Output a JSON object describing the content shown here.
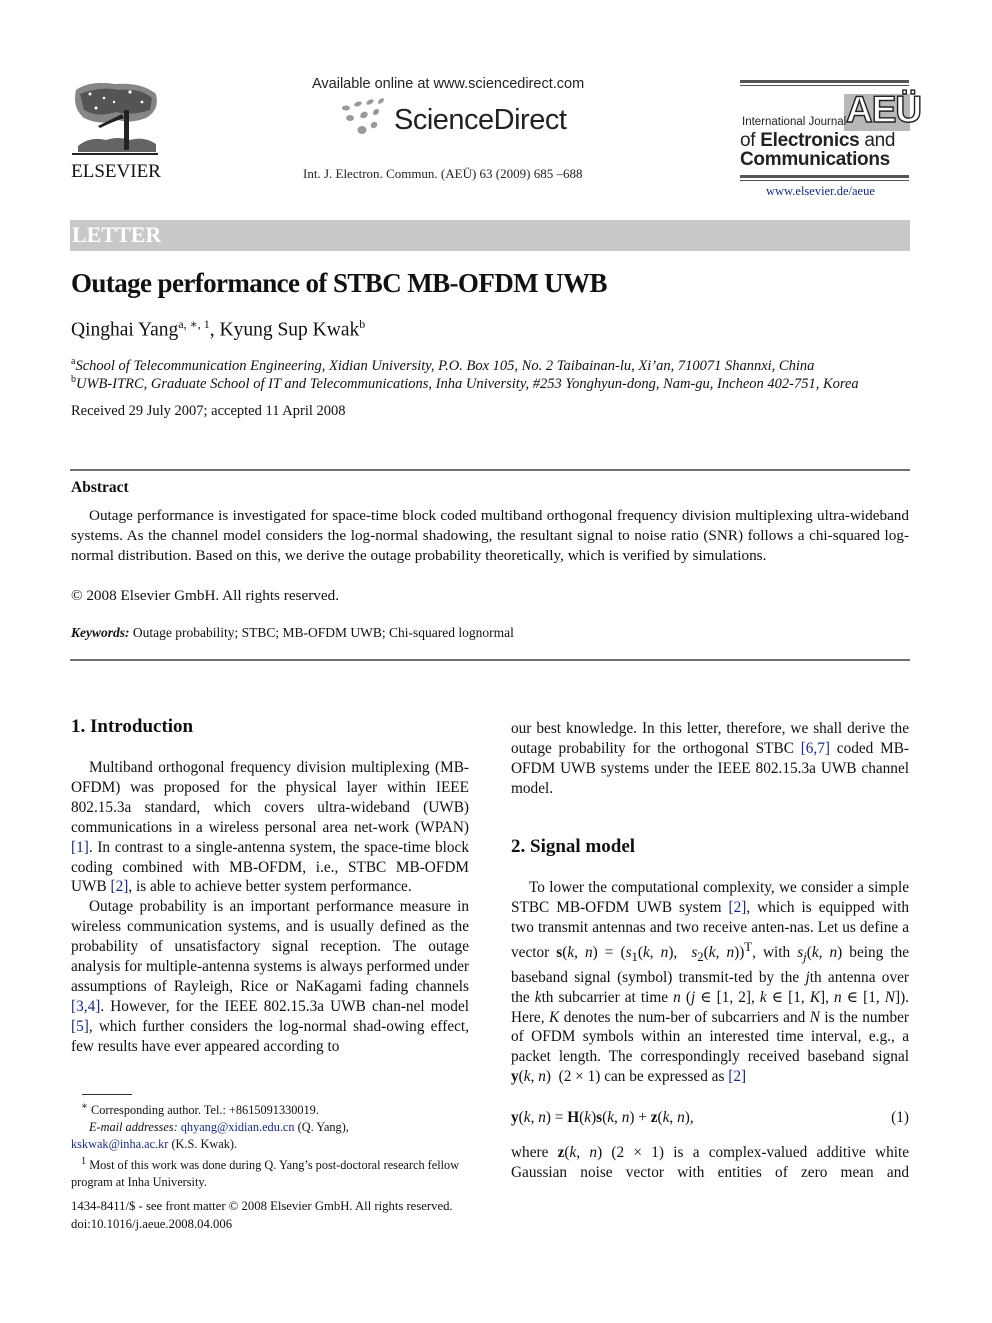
{
  "header": {
    "publisher_logo_label": "ELSEVIER",
    "available_online": "Available online at www.sciencedirect.com",
    "platform_name": "ScienceDirect",
    "citation": "Int. J. Electron. Commun. (AEÜ) 63 (2009) 685 –688",
    "journal_logo": {
      "letters": "AEÜ",
      "line1": "International Journal",
      "line2_light": "of ",
      "line2_bold": "Electronics",
      "line2_end": " and",
      "line3": "Communications"
    },
    "journal_url": "www.elsevier.de/aeue"
  },
  "article": {
    "type_label": "LETTER",
    "title": "Outage performance of STBC MB-OFDM UWB",
    "authors": [
      {
        "name": "Qinghai Yang",
        "marks": "a, ∗, 1"
      },
      {
        "name": "Kyung Sup Kwak",
        "marks": "b"
      }
    ],
    "author_separator": ", ",
    "affiliations": [
      {
        "mark": "a",
        "text": "School of Telecommunication Engineering, Xidian University, P.O. Box 105, No. 2 Taibainan-lu, Xi’an, 710071 Shannxi, China"
      },
      {
        "mark": "b",
        "text": "UWB-ITRC, Graduate School of IT and Telecommunications, Inha University, #253 Yonghyun-dong, Nam-gu, Incheon 402-751, Korea"
      }
    ],
    "received": "Received 29 July 2007; accepted 11 April 2008"
  },
  "abstract": {
    "heading": "Abstract",
    "text": "Outage performance is investigated for space-time block coded multiband orthogonal frequency division multiplexing ultra-wideband systems. As the channel model considers the log-normal shadowing, the resultant signal to noise ratio (SNR) follows a chi-squared log-normal distribution. Based on this, we derive the outage probability theoretically, which is verified by simulations.",
    "copyright": "© 2008 Elsevier GmbH. All rights reserved.",
    "keywords_label": "Keywords:",
    "keywords": "Outage probability; STBC; MB-OFDM UWB; Chi-squared lognormal"
  },
  "sections": {
    "intro": {
      "heading": "1.  Introduction",
      "p1": [
        "Multiband orthogonal frequency division multiplexing (MB-OFDM) was proposed for the physical layer within IEEE 802.15.3a standard, which covers ultra-wideband (UWB) communications in a wireless personal area net-work (WPAN) ",
        "[1]",
        ". In contrast to a single-antenna system, the space-time block coding combined with MB-OFDM, i.e., STBC MB-OFDM UWB ",
        "[2]",
        ", is able to achieve better system performance."
      ],
      "p2": [
        "Outage probability is an important performance measure in wireless communication systems, and is usually defined as the probability of unsatisfactory signal reception. The outage analysis for multiple-antenna systems is always performed under assumptions of Rayleigh, Rice or NaKagami fading channels ",
        "[3,4]",
        ". However, for the IEEE 802.15.3a UWB chan-nel model ",
        "[5]",
        ", which further considers the log-normal shad-owing effect, few results have ever appeared according to"
      ],
      "continued": [
        "our best knowledge. In this letter, therefore, we shall derive the outage probability for the orthogonal STBC ",
        "[6,7]",
        " coded MB-OFDM UWB systems under the IEEE 802.15.3a UWB channel model."
      ]
    },
    "signal_model": {
      "heading": "2.  Signal model",
      "p1_a": "To lower the computational complexity, we consider a simple STBC MB-OFDM UWB system ",
      "p1_ref1": "[2]",
      "p1_b": ", which is equipped with two transmit antennas and two receive anten-nas. Let us define a vector ",
      "p1_c": "with ",
      "p1_d": " being the baseband signal (symbol) transmit-ted by the ",
      "p1_e": "th antenna over the ",
      "p1_f": "th subcarrier at time ",
      "p1_g": "). Here, ",
      "p1_h": " denotes the num-ber of subcarriers and ",
      "p1_i": " is the number of OFDM symbols within an interested time interval, e.g., a packet length. The correspondingly received baseband signal ",
      "p1_j": " can be expressed as ",
      "p1_ref2": "[2]",
      "equation_number": "(1)",
      "p2_a": "where ",
      "p2_b": " (2 × 1) is a complex-valued additive white Gaussian noise vector with entities of zero mean and"
    }
  },
  "footnotes": {
    "corresponding": "Corresponding author. Tel.: +8615091330019.",
    "email_label": "E-mail addresses:",
    "email1": "qhyang@xidian.edu.cn",
    "email1_owner": " (Q. Yang),",
    "email2": "kskwak@inha.ac.kr",
    "email2_owner": " (K.S. Kwak).",
    "note1": "Most of this work was done during Q. Yang’s post-doctoral research fellow program at Inha University."
  },
  "front_matter": {
    "issn_line": "1434-8411/$ - see front matter © 2008 Elsevier GmbH. All rights reserved.",
    "doi": "doi:10.1016/j.aeue.2008.04.006"
  },
  "colors": {
    "link": "#1a2a7a",
    "letter_bar": "#c8c8c8",
    "rule": "#707070"
  }
}
